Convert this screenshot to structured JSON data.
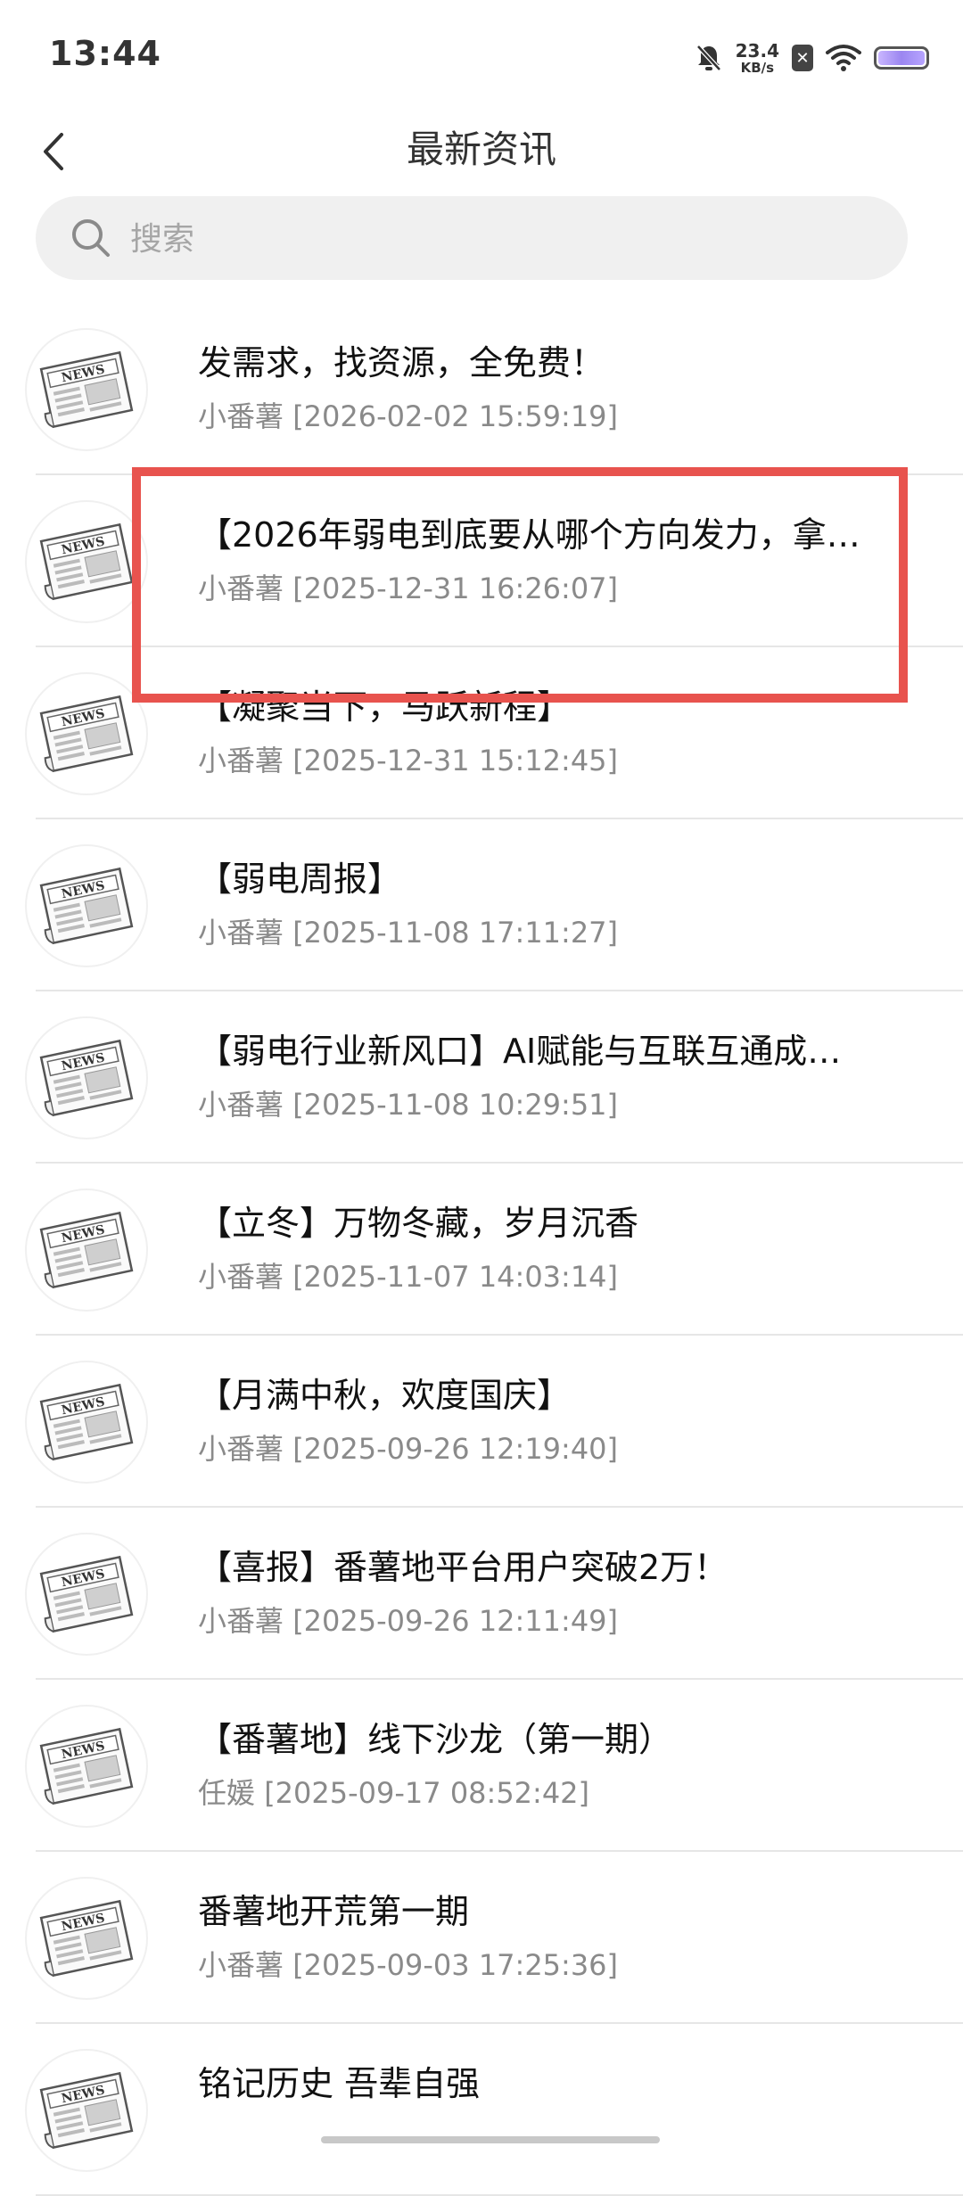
{
  "status_bar": {
    "time": "13:44",
    "net_speed_value": "23.4",
    "net_speed_unit": "KB/s"
  },
  "header": {
    "title": "最新资讯"
  },
  "search": {
    "placeholder": "搜索"
  },
  "news": [
    {
      "title": "发需求，找资源，全免费！",
      "author": "小番薯",
      "time": "[2026-02-02 15:59:19]"
    },
    {
      "title": "【2026年弱电到底要从哪个方向发力，拿…",
      "author": "小番薯",
      "time": "[2025-12-31 16:26:07]"
    },
    {
      "title": "【凝聚当下，马跃新程】",
      "author": "小番薯",
      "time": "[2025-12-31 15:12:45]"
    },
    {
      "title": "【弱电周报】",
      "author": "小番薯",
      "time": "[2025-11-08 17:11:27]"
    },
    {
      "title": "【弱电行业新风口】AI赋能与互联互通成…",
      "author": "小番薯",
      "time": "[2025-11-08 10:29:51]"
    },
    {
      "title": "【立冬】万物冬藏，岁月沉香",
      "author": "小番薯",
      "time": "[2025-11-07 14:03:14]"
    },
    {
      "title": "【月满中秋，欢度国庆】",
      "author": "小番薯",
      "time": "[2025-09-26 12:19:40]"
    },
    {
      "title": "【喜报】番薯地平台用户突破2万！",
      "author": "小番薯",
      "time": "[2025-09-26 12:11:49]"
    },
    {
      "title": "【番薯地】线下沙龙（第一期）",
      "author": "任媛",
      "time": "[2025-09-17 08:52:42]"
    },
    {
      "title": "番薯地开荒第一期",
      "author": "小番薯",
      "time": "[2025-09-03 17:25:36]"
    },
    {
      "title": "铭记历史 吾辈自强",
      "author": "",
      "time": ""
    }
  ],
  "thumbnail_label": "NEWS",
  "colors": {
    "highlight": "#e8534e",
    "search_bg": "#f0f0f0"
  }
}
